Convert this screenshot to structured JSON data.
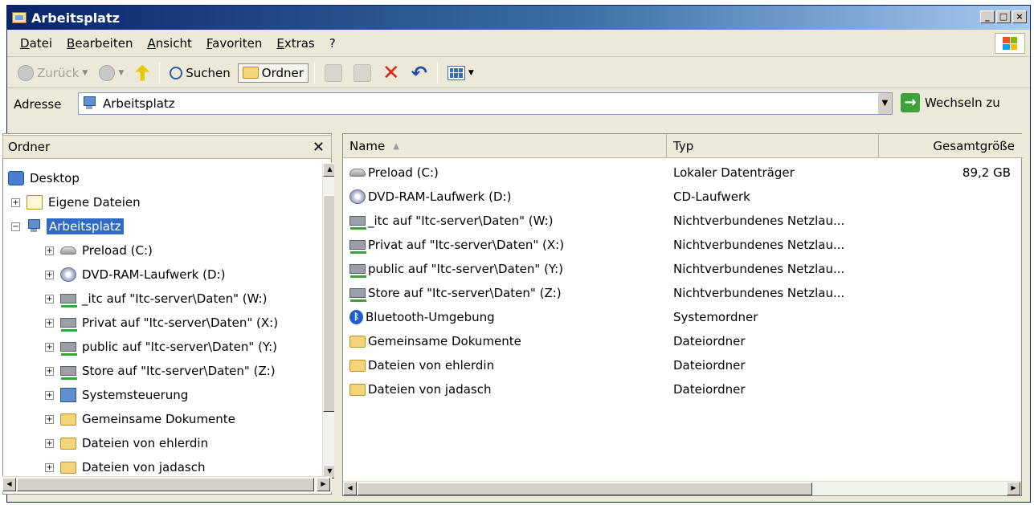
{
  "window": {
    "title": "Arbeitsplatz"
  },
  "menubar": {
    "items": [
      "Datei",
      "Bearbeiten",
      "Ansicht",
      "Favoriten",
      "Extras",
      "?"
    ]
  },
  "toolbar": {
    "back_label": "Zurück",
    "search_label": "Suchen",
    "folders_label": "Ordner"
  },
  "address": {
    "label": "Adresse",
    "value": "Arbeitsplatz",
    "go_label": "Wechseln zu"
  },
  "folders_panel": {
    "title": "Ordner",
    "tree": [
      {
        "label": "Desktop",
        "icon": "desktop-icon",
        "level": 0,
        "expander": ""
      },
      {
        "label": "Eigene Dateien",
        "icon": "documents-icon",
        "level": 1,
        "expander": "+"
      },
      {
        "label": "Arbeitsplatz",
        "icon": "computer-icon",
        "level": 1,
        "expander": "−",
        "selected": true
      },
      {
        "label": "Preload (C:)",
        "icon": "hard-drive-icon",
        "level": 2,
        "expander": "+"
      },
      {
        "label": "DVD-RAM-Laufwerk (D:)",
        "icon": "cd-drive-icon",
        "level": 2,
        "expander": "+"
      },
      {
        "label": "_itc auf \"Itc-server\\Daten\" (W:)",
        "icon": "network-drive-icon",
        "level": 2,
        "expander": "+"
      },
      {
        "label": "Privat auf \"Itc-server\\Daten\" (X:)",
        "icon": "network-drive-icon",
        "level": 2,
        "expander": "+"
      },
      {
        "label": "public auf \"Itc-server\\Daten\" (Y:)",
        "icon": "network-drive-icon",
        "level": 2,
        "expander": "+"
      },
      {
        "label": "Store auf \"Itc-server\\Daten\" (Z:)",
        "icon": "network-drive-icon",
        "level": 2,
        "expander": "+"
      },
      {
        "label": "Systemsteuerung",
        "icon": "control-panel-icon",
        "level": 2,
        "expander": "+"
      },
      {
        "label": "Gemeinsame Dokumente",
        "icon": "folder-icon",
        "level": 2,
        "expander": "+"
      },
      {
        "label": "Dateien von ehlerdin",
        "icon": "folder-icon",
        "level": 2,
        "expander": "+"
      },
      {
        "label": "Dateien von jadasch",
        "icon": "folder-icon",
        "level": 2,
        "expander": "+"
      }
    ]
  },
  "list": {
    "columns": {
      "name": "Name",
      "type": "Typ",
      "size": "Gesamtgröße"
    },
    "rows": [
      {
        "name": "Preload (C:)",
        "type": "Lokaler Datenträger",
        "size": "89,2 GB",
        "icon": "hard-drive-icon"
      },
      {
        "name": "DVD-RAM-Laufwerk (D:)",
        "type": "CD-Laufwerk",
        "size": "",
        "icon": "cd-drive-icon"
      },
      {
        "name": "_itc auf \"Itc-server\\Daten\" (W:)",
        "type": "Nichtverbundenes Netzlau...",
        "size": "",
        "icon": "network-drive-icon"
      },
      {
        "name": "Privat auf \"Itc-server\\Daten\" (X:)",
        "type": "Nichtverbundenes Netzlau...",
        "size": "",
        "icon": "network-drive-icon"
      },
      {
        "name": "public auf \"Itc-server\\Daten\" (Y:)",
        "type": "Nichtverbundenes Netzlau...",
        "size": "",
        "icon": "network-drive-icon"
      },
      {
        "name": "Store auf \"Itc-server\\Daten\" (Z:)",
        "type": "Nichtverbundenes Netzlau...",
        "size": "",
        "icon": "network-drive-icon"
      },
      {
        "name": "Bluetooth-Umgebung",
        "type": "Systemordner",
        "size": "",
        "icon": "bluetooth-icon"
      },
      {
        "name": "Gemeinsame Dokumente",
        "type": "Dateiordner",
        "size": "",
        "icon": "folder-icon"
      },
      {
        "name": "Dateien von ehlerdin",
        "type": "Dateiordner",
        "size": "",
        "icon": "folder-icon"
      },
      {
        "name": "Dateien von jadasch",
        "type": "Dateiordner",
        "size": "",
        "icon": "folder-icon"
      }
    ]
  }
}
